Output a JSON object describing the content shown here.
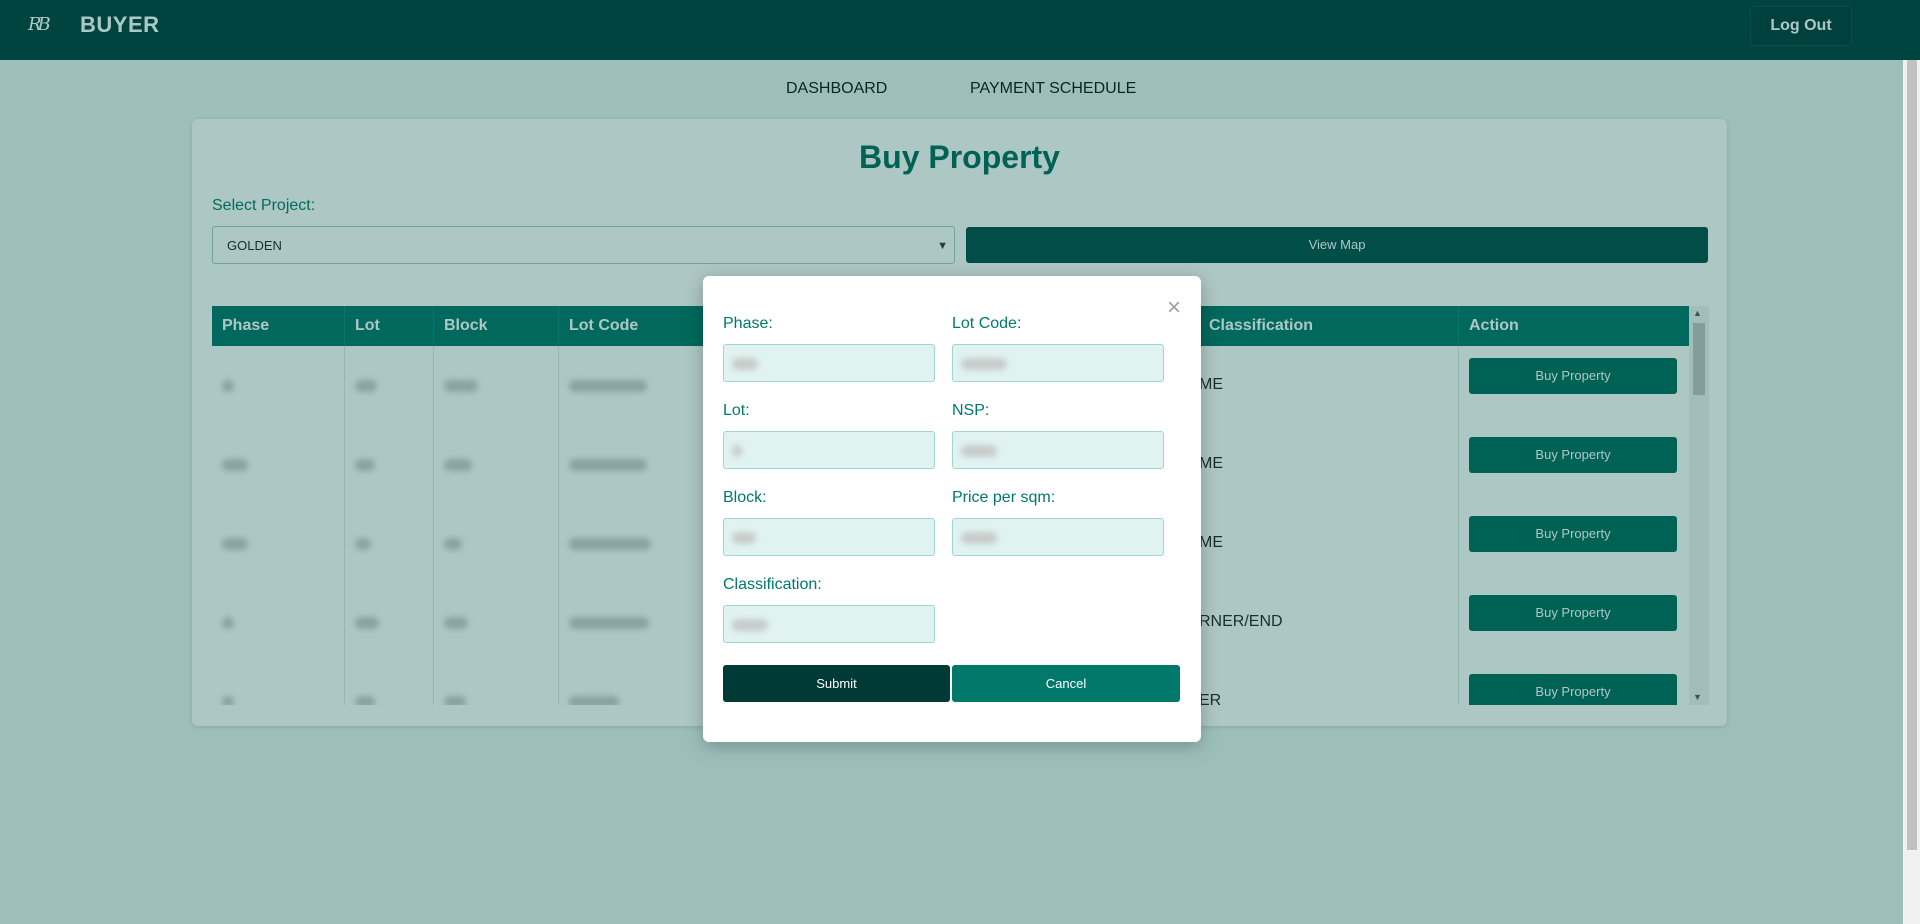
{
  "header": {
    "logo_text": "RB",
    "app_title": "BUYER",
    "logout_label": "Log Out"
  },
  "nav": {
    "items": [
      "DASHBOARD",
      "PAYMENT SCHEDULE"
    ]
  },
  "page": {
    "title": "Buy Property",
    "select_label": "Select Project:",
    "selected_project": "GOLDEN",
    "view_map_label": "View Map"
  },
  "table": {
    "columns": [
      "Phase",
      "Lot",
      "Block",
      "Lot Code",
      "Classification",
      "Action"
    ],
    "rows": [
      {
        "classification_visible": "ME",
        "action": "Buy Property"
      },
      {
        "classification_visible": "ME",
        "action": "Buy Property"
      },
      {
        "classification_visible": "ME",
        "action": "Buy Property"
      },
      {
        "classification_visible": "RNER/END",
        "action": "Buy Property"
      },
      {
        "classification_visible": "ER",
        "action": "Buy Property"
      }
    ]
  },
  "modal": {
    "close_icon": "×",
    "fields": {
      "phase": "Phase:",
      "lot_code": "Lot Code:",
      "lot": "Lot:",
      "nsp": "NSP:",
      "block": "Block:",
      "price_per_sqm": "Price per sqm:",
      "classification": "Classification:"
    },
    "submit_label": "Submit",
    "cancel_label": "Cancel"
  }
}
